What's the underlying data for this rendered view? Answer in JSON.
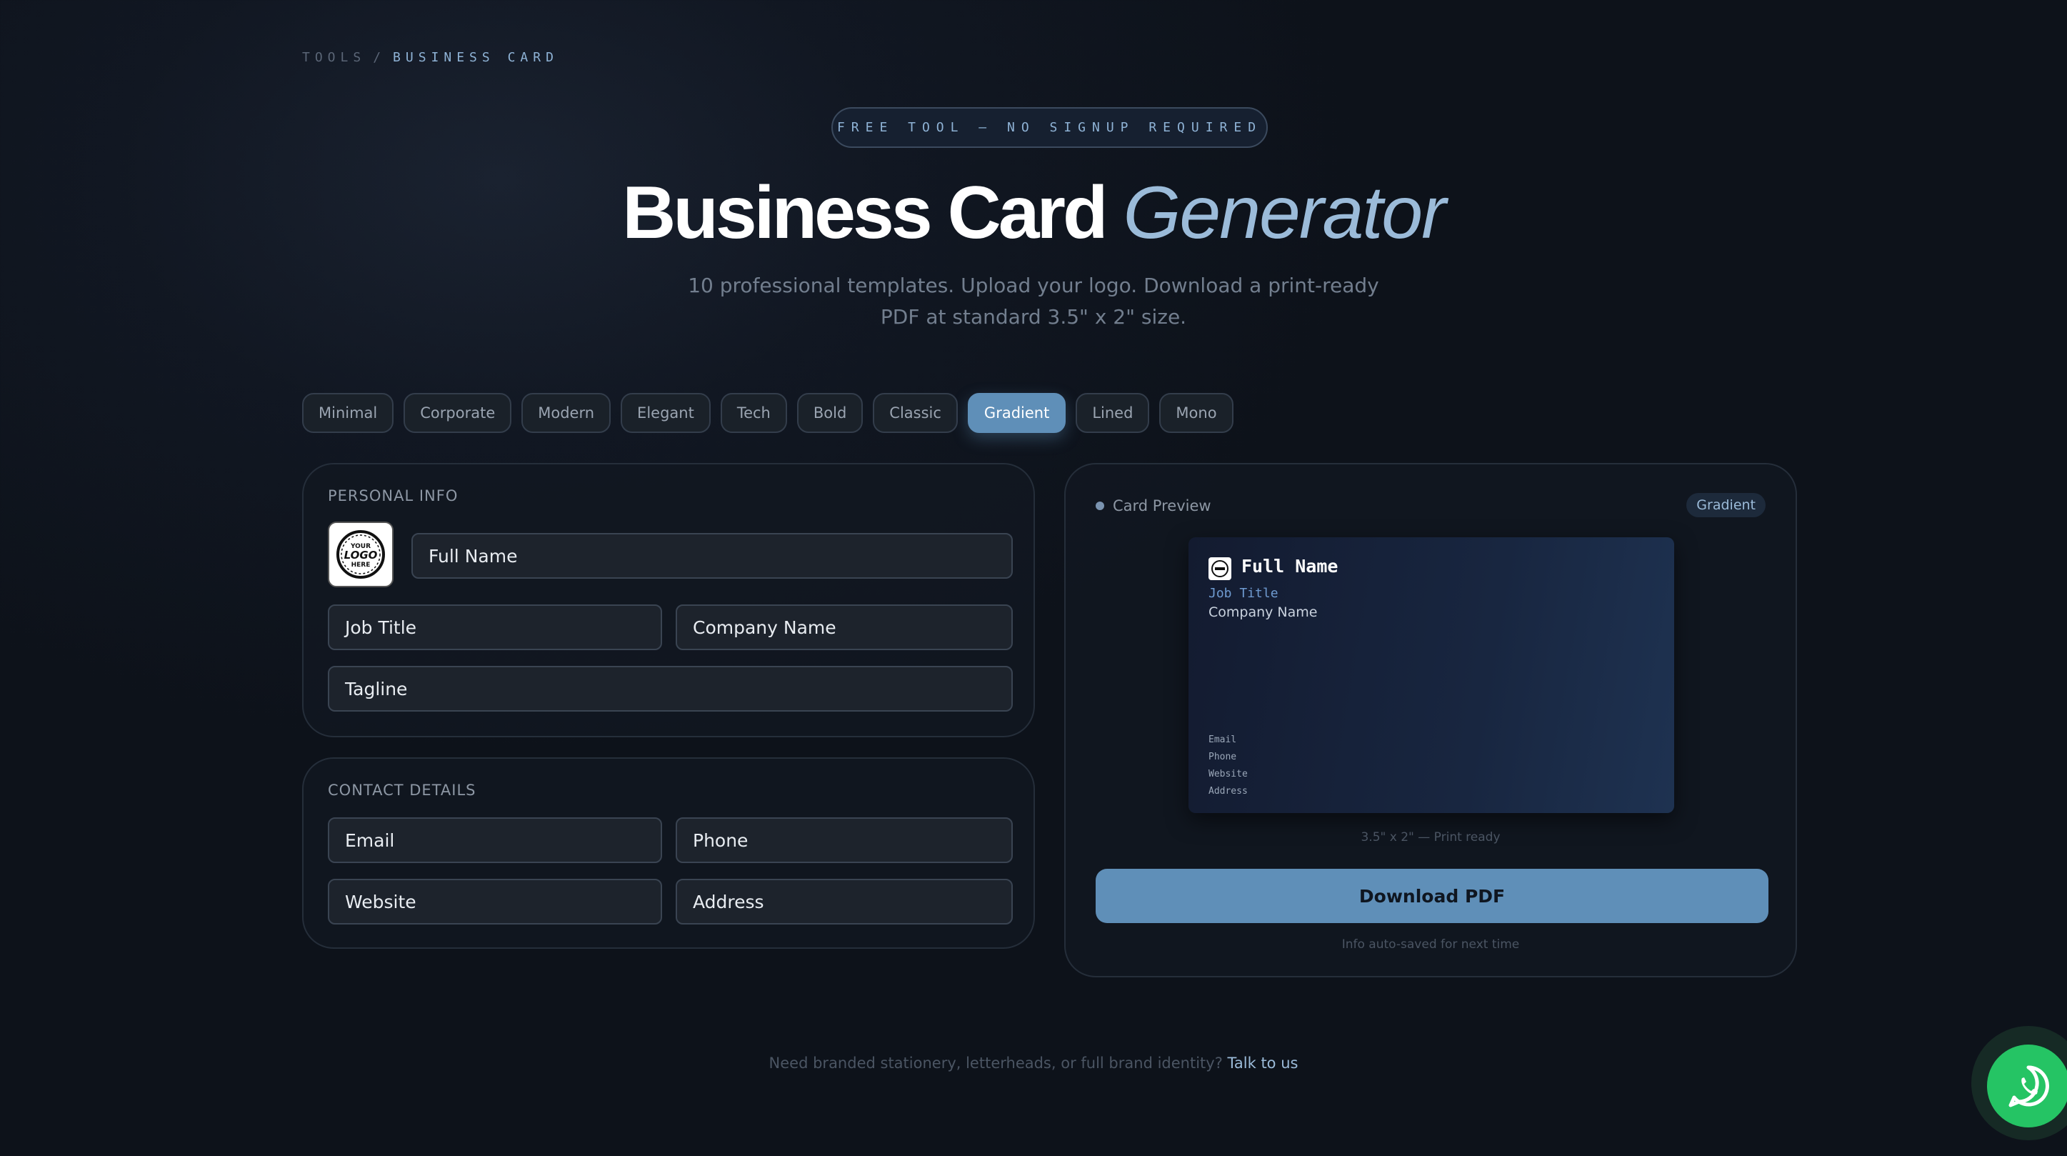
{
  "breadcrumb": {
    "parent": "TOOLS",
    "separator": "/",
    "current": "BUSINESS CARD"
  },
  "hero": {
    "pill": "FREE TOOL — NO SIGNUP REQUIRED",
    "title_bold": "Business Card",
    "title_italic": "Generator",
    "subtitle_line1": "10 professional templates. Upload your logo. Download a print-ready",
    "subtitle_line2": "PDF at standard 3.5\" x 2\" size."
  },
  "templates": {
    "items": [
      "Minimal",
      "Corporate",
      "Modern",
      "Elegant",
      "Tech",
      "Bold",
      "Classic",
      "Gradient",
      "Lined",
      "Mono"
    ],
    "selected": "Gradient"
  },
  "personal": {
    "title": "PERSONAL INFO",
    "logo_alt": "YOUR LOGO HERE",
    "full_name": "Full Name",
    "job_title": "Job Title",
    "company": "Company Name",
    "tagline": "Tagline"
  },
  "contact": {
    "title": "CONTACT DETAILS",
    "email": "Email",
    "phone": "Phone",
    "website": "Website",
    "address": "Address"
  },
  "preview": {
    "label": "Card Preview",
    "badge": "Gradient",
    "card": {
      "name": "Full Name",
      "job_title": "Job Title",
      "company": "Company Name",
      "contacts": [
        "Email",
        "Phone",
        "Website",
        "Address"
      ]
    },
    "print_note": "3.5\" x 2\" — Print ready",
    "download_label": "Download PDF",
    "save_note": "Info auto-saved for next time"
  },
  "footer": {
    "text": "Need branded stationery, letterheads, or full brand identity?",
    "link": "Talk to us"
  },
  "colors": {
    "accent": "#5f8fb8",
    "background": "#0f141c",
    "whatsapp": "#25c464"
  },
  "icons": {
    "logo_placeholder": "logo-placeholder-icon",
    "whatsapp": "whatsapp-icon"
  }
}
